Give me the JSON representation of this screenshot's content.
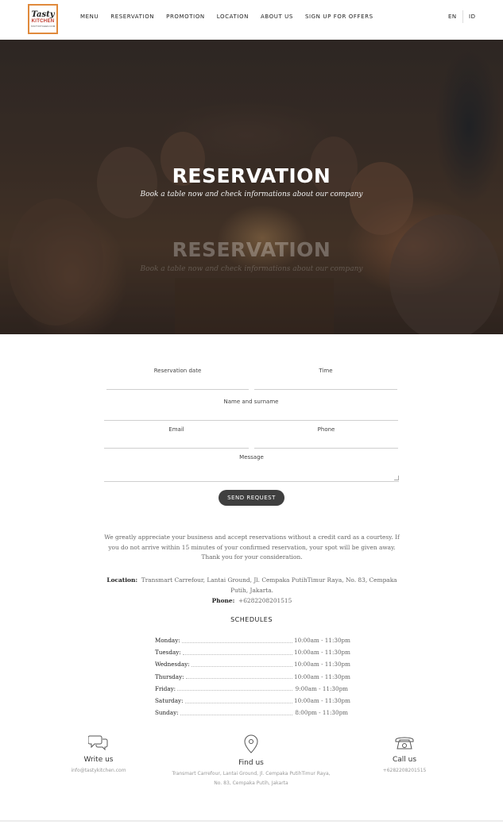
{
  "logo": {
    "line1": "Tasty",
    "line2": "KITCHEN",
    "line3": "TASTYKITCHEN.COM"
  },
  "nav": {
    "items": [
      "MENU",
      "RESERVATION",
      "PROMOTION",
      "LOCATION",
      "ABOUT US",
      "SIGN UP FOR OFFERS"
    ]
  },
  "lang": {
    "en": "EN",
    "id": "ID"
  },
  "hero": {
    "title": "RESERVATION",
    "subtitle": "Book a table now and check informations about our company"
  },
  "form": {
    "date_label": "Reservation date",
    "time_label": "Time",
    "name_label": "Name and surname",
    "email_label": "Email",
    "phone_label": "Phone",
    "message_label": "Message",
    "send_label": "SEND REQUEST"
  },
  "notice": "We greatly appreciate your business and accept reservations without a credit card as a courtesy. If you do not arrive within 15 minutes of your confirmed reservation, your spot will be given away. Thank you for your consideration.",
  "info": {
    "location_label": "Location:",
    "location_value": "Transmart Carrefour, Lantai Ground, Jl. Cempaka PutihTimur Raya, No. 83, Cempaka Putih, Jakarta.",
    "phone_label": "Phone:",
    "phone_value": "+6282208201515"
  },
  "schedules": {
    "title": "SCHEDULES",
    "rows": [
      {
        "day": "Monday:",
        "time": "10:00am - 11:30pm"
      },
      {
        "day": "Tuesday:",
        "time": "10:00am - 11:30pm"
      },
      {
        "day": "Wednesday:",
        "time": "10:00am - 11:30pm"
      },
      {
        "day": "Thursday:",
        "time": "10:00am - 11:30pm"
      },
      {
        "day": "Friday:",
        "time": "9:00am - 11:30pm"
      },
      {
        "day": "Saturday:",
        "time": "10:00am - 11:30pm"
      },
      {
        "day": "Sunday:",
        "time": "8:00pm - 11:30pm"
      }
    ]
  },
  "contact": {
    "write": {
      "title": "Write us",
      "text": "info@tastykitchen.com",
      "icon": "chat-icon"
    },
    "find": {
      "title": "Find us",
      "text": "Transmart Carrefour, Lantai Ground, Jl. Cempaka PutihTimur Raya, No. 83, Cempaka Putih, Jakarta",
      "icon": "map-pin-icon"
    },
    "call": {
      "title": "Call us",
      "text": "+6282208201515",
      "icon": "phone-icon"
    }
  },
  "colors": {
    "logo_border": "#e08a3c",
    "button": "#3f3f3f"
  }
}
